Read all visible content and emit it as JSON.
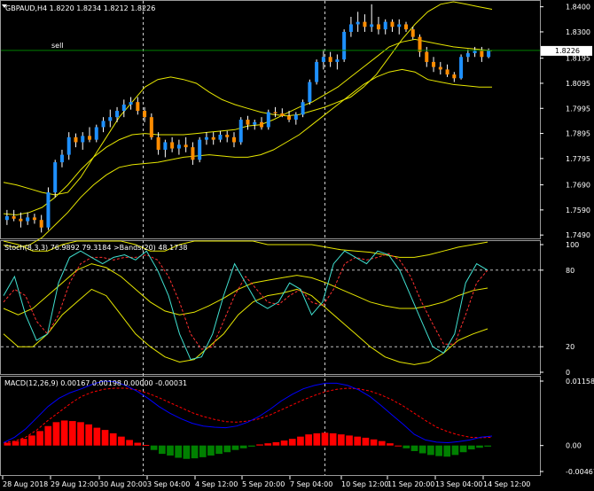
{
  "symbol_line": "GBPAUD,H4  1.8220 1.8234 1.8212 1.8226",
  "trade_label": "sell",
  "price_badge": "1.8226",
  "stoch_label": "Stoch(8,3,3) 76.9892 79.3184  >Bands(20) 48.1738",
  "macd_label": "MACD(12,26,9) 0.00167 0.00198 0.00000 -0.00031",
  "colors": {
    "bull": "#1e90ff",
    "bear": "#ff8c00",
    "band": "#e6e600",
    "stoch_main": "#40e0d0",
    "stoch_signal": "#ff3030",
    "macd_main": "#0000ff",
    "macd_signal": "#ff0000",
    "hist_pos": "#ff0000",
    "hist_neg": "#008000",
    "sell_line": "#008000",
    "grid": "#c0c0c0"
  },
  "chart_data": [
    {
      "type": "candlestick",
      "symbol": "GBPAUD",
      "timeframe": "H4",
      "yticks": [
        "1.8400",
        "1.8300",
        "1.8195",
        "1.8095",
        "1.7995",
        "1.7895",
        "1.7795",
        "1.7690",
        "1.7590",
        "1.7490"
      ],
      "ylim": [
        1.748,
        1.842
      ],
      "current_price": 1.8226,
      "sell_level": 1.8226,
      "candles": [
        [
          1.755,
          1.759,
          1.753,
          1.7565
        ],
        [
          1.7565,
          1.759,
          1.7545,
          1.7555
        ],
        [
          1.7555,
          1.758,
          1.752,
          1.7545
        ],
        [
          1.7545,
          1.758,
          1.753,
          1.756
        ],
        [
          1.756,
          1.7575,
          1.7535,
          1.755
        ],
        [
          1.755,
          1.757,
          1.75,
          1.752
        ],
        [
          1.752,
          1.768,
          1.751,
          1.766
        ],
        [
          1.766,
          1.779,
          1.764,
          1.778
        ],
        [
          1.778,
          1.783,
          1.776,
          1.781
        ],
        [
          1.781,
          1.79,
          1.779,
          1.788
        ],
        [
          1.788,
          1.7895,
          1.784,
          1.786
        ],
        [
          1.786,
          1.79,
          1.783,
          1.7885
        ],
        [
          1.7885,
          1.792,
          1.786,
          1.787
        ],
        [
          1.787,
          1.793,
          1.786,
          1.792
        ],
        [
          1.792,
          1.796,
          1.79,
          1.7945
        ],
        [
          1.7945,
          1.799,
          1.792,
          1.796
        ],
        [
          1.796,
          1.8,
          1.794,
          1.7985
        ],
        [
          1.7985,
          1.803,
          1.796,
          1.801
        ],
        [
          1.801,
          1.804,
          1.799,
          1.802
        ],
        [
          1.802,
          1.804,
          1.797,
          1.7985
        ],
        [
          1.7985,
          1.8,
          1.794,
          1.796
        ],
        [
          1.796,
          1.7975,
          1.787,
          1.788
        ],
        [
          1.788,
          1.79,
          1.781,
          1.783
        ],
        [
          1.783,
          1.787,
          1.78,
          1.786
        ],
        [
          1.786,
          1.788,
          1.782,
          1.7835
        ],
        [
          1.7835,
          1.787,
          1.781,
          1.785
        ],
        [
          1.785,
          1.788,
          1.782,
          1.784
        ],
        [
          1.784,
          1.786,
          1.777,
          1.779
        ],
        [
          1.779,
          1.788,
          1.778,
          1.787
        ],
        [
          1.787,
          1.79,
          1.785,
          1.788
        ],
        [
          1.788,
          1.79,
          1.785,
          1.787
        ],
        [
          1.787,
          1.7905,
          1.786,
          1.789
        ],
        [
          1.789,
          1.7905,
          1.786,
          1.788
        ],
        [
          1.788,
          1.79,
          1.784,
          1.786
        ],
        [
          1.786,
          1.796,
          1.785,
          1.795
        ],
        [
          1.795,
          1.7965,
          1.791,
          1.793
        ],
        [
          1.793,
          1.795,
          1.791,
          1.794
        ],
        [
          1.794,
          1.796,
          1.791,
          1.792
        ],
        [
          1.792,
          1.799,
          1.791,
          1.798
        ],
        [
          1.798,
          1.8,
          1.796,
          1.7975
        ],
        [
          1.7975,
          1.7995,
          1.796,
          1.7965
        ],
        [
          1.7965,
          1.7985,
          1.794,
          1.795
        ],
        [
          1.795,
          1.798,
          1.793,
          1.797
        ],
        [
          1.797,
          1.803,
          1.796,
          1.802
        ],
        [
          1.802,
          1.811,
          1.801,
          1.81
        ],
        [
          1.81,
          1.819,
          1.809,
          1.818
        ],
        [
          1.818,
          1.823,
          1.815,
          1.82
        ],
        [
          1.82,
          1.822,
          1.816,
          1.818
        ],
        [
          1.818,
          1.821,
          1.815,
          1.819
        ],
        [
          1.819,
          1.831,
          1.818,
          1.83
        ],
        [
          1.83,
          1.836,
          1.828,
          1.833
        ],
        [
          1.833,
          1.838,
          1.83,
          1.834
        ],
        [
          1.834,
          1.837,
          1.83,
          1.832
        ],
        [
          1.832,
          1.841,
          1.83,
          1.833
        ],
        [
          1.833,
          1.836,
          1.829,
          1.831
        ],
        [
          1.831,
          1.835,
          1.829,
          1.834
        ],
        [
          1.834,
          1.835,
          1.83,
          1.832
        ],
        [
          1.832,
          1.835,
          1.829,
          1.833
        ],
        [
          1.833,
          1.834,
          1.83,
          1.831
        ],
        [
          1.831,
          1.832,
          1.827,
          1.828
        ],
        [
          1.828,
          1.829,
          1.82,
          1.822
        ],
        [
          1.822,
          1.824,
          1.816,
          1.818
        ],
        [
          1.818,
          1.82,
          1.814,
          1.816
        ],
        [
          1.816,
          1.818,
          1.813,
          1.815
        ],
        [
          1.815,
          1.817,
          1.812,
          1.813
        ],
        [
          1.813,
          1.814,
          1.81,
          1.8115
        ],
        [
          1.8115,
          1.821,
          1.811,
          1.82
        ],
        [
          1.82,
          1.823,
          1.818,
          1.8215
        ],
        [
          1.8215,
          1.824,
          1.82,
          1.8225
        ],
        [
          1.8225,
          1.824,
          1.818,
          1.82
        ],
        [
          1.82,
          1.8234,
          1.8195,
          1.8226
        ]
      ],
      "bands": {
        "upper": [
          1.77,
          1.769,
          1.7675,
          1.766,
          1.765,
          1.766,
          1.772,
          1.78,
          1.788,
          1.796,
          1.802,
          1.808,
          1.811,
          1.812,
          1.811,
          1.8095,
          1.806,
          1.803,
          1.801,
          1.7995,
          1.798,
          1.797,
          1.7965,
          1.797,
          1.7985,
          1.8,
          1.802,
          1.804,
          1.808,
          1.813,
          1.82,
          1.827,
          1.833,
          1.838,
          1.841,
          1.842,
          1.841,
          1.84,
          1.839
        ],
        "middle": [
          1.7575,
          1.757,
          1.758,
          1.76,
          1.764,
          1.769,
          1.775,
          1.78,
          1.784,
          1.787,
          1.789,
          1.7895,
          1.789,
          1.789,
          1.789,
          1.7895,
          1.79,
          1.7905,
          1.791,
          1.7925,
          1.793,
          1.795,
          1.7975,
          1.8,
          1.802,
          1.805,
          1.808,
          1.812,
          1.816,
          1.82,
          1.824,
          1.826,
          1.827,
          1.826,
          1.825,
          1.824,
          1.8235,
          1.823,
          1.8225
        ],
        "lower": [
          1.745,
          1.744,
          1.745,
          1.748,
          1.753,
          1.758,
          1.764,
          1.769,
          1.773,
          1.776,
          1.777,
          1.7775,
          1.778,
          1.779,
          1.78,
          1.7805,
          1.781,
          1.7805,
          1.78,
          1.78,
          1.781,
          1.783,
          1.786,
          1.789,
          1.793,
          1.797,
          1.801,
          1.805,
          1.809,
          1.812,
          1.814,
          1.815,
          1.814,
          1.811,
          1.81,
          1.809,
          1.8085,
          1.808,
          1.808
        ]
      }
    },
    {
      "type": "line",
      "name": "Stoch(8,3,3)",
      "yticks": [
        "100",
        "80",
        "20",
        "0"
      ],
      "ylim": [
        0,
        100
      ],
      "levels": [
        80,
        20
      ],
      "main": [
        60,
        75,
        45,
        25,
        30,
        70,
        90,
        95,
        90,
        85,
        90,
        92,
        88,
        95,
        80,
        60,
        30,
        10,
        12,
        30,
        60,
        85,
        70,
        55,
        50,
        55,
        70,
        65,
        45,
        55,
        85,
        95,
        90,
        85,
        95,
        92,
        80,
        60,
        40,
        20,
        15,
        30,
        70,
        85,
        80
      ],
      "signal": [
        55,
        65,
        60,
        40,
        30,
        45,
        70,
        85,
        90,
        90,
        88,
        90,
        90,
        92,
        88,
        75,
        55,
        30,
        18,
        20,
        40,
        60,
        75,
        65,
        55,
        53,
        60,
        65,
        55,
        52,
        65,
        85,
        90,
        88,
        90,
        93,
        88,
        75,
        55,
        38,
        22,
        22,
        45,
        70,
        80
      ],
      "bands": {
        "upper": [
          105,
          100,
          95,
          95,
          100,
          105,
          110,
          110,
          105,
          100,
          95,
          95,
          100,
          105,
          108,
          110,
          110,
          105,
          100,
          100,
          100,
          100,
          98,
          96,
          95,
          94,
          92,
          90,
          90,
          92,
          95,
          98,
          100,
          102
        ],
        "middle": [
          50,
          45,
          50,
          60,
          70,
          80,
          85,
          82,
          75,
          65,
          55,
          48,
          45,
          47,
          52,
          58,
          65,
          70,
          72,
          74,
          76,
          74,
          70,
          65,
          60,
          55,
          52,
          50,
          50,
          52,
          55,
          60,
          64,
          66
        ],
        "lower": [
          30,
          20,
          20,
          30,
          45,
          55,
          65,
          60,
          45,
          30,
          20,
          12,
          8,
          10,
          20,
          30,
          45,
          55,
          60,
          62,
          65,
          60,
          50,
          40,
          30,
          20,
          12,
          8,
          6,
          8,
          15,
          25,
          30,
          34
        ]
      }
    },
    {
      "type": "bar+line",
      "name": "MACD(12,26,9)",
      "yticks": [
        "0.01158",
        "0.00",
        "-0.00467"
      ],
      "ylim": [
        -0.00467,
        0.01158
      ],
      "histogram": [
        0.0005,
        0.0008,
        0.0012,
        0.0018,
        0.0026,
        0.0035,
        0.0042,
        0.0045,
        0.0044,
        0.0042,
        0.0038,
        0.0032,
        0.0028,
        0.0022,
        0.0016,
        0.001,
        0.0005,
        0.0001,
        -0.0008,
        -0.0015,
        -0.0018,
        -0.0022,
        -0.0024,
        -0.0023,
        -0.0021,
        -0.0018,
        -0.0015,
        -0.0012,
        -0.0008,
        -0.0005,
        -0.0002,
        0.0002,
        0.0004,
        0.0006,
        0.0009,
        0.0012,
        0.0016,
        0.002,
        0.0022,
        0.0023,
        0.0022,
        0.002,
        0.0018,
        0.0016,
        0.0014,
        0.0011,
        0.0008,
        0.0004,
        0.0,
        -0.0005,
        -0.001,
        -0.0014,
        -0.0017,
        -0.0019,
        -0.002,
        -0.0017,
        -0.0012,
        -0.0007,
        -0.0004,
        -0.0002
      ],
      "main": [
        0.0005,
        0.0015,
        0.003,
        0.005,
        0.007,
        0.0085,
        0.0095,
        0.0102,
        0.011,
        0.0116,
        0.0115,
        0.0108,
        0.0098,
        0.0085,
        0.007,
        0.0058,
        0.0048,
        0.004,
        0.0035,
        0.0033,
        0.0032,
        0.0035,
        0.0042,
        0.0052,
        0.0065,
        0.008,
        0.0092,
        0.0102,
        0.0108,
        0.0112,
        0.0112,
        0.0108,
        0.01,
        0.0088,
        0.0072,
        0.0055,
        0.0038,
        0.002,
        0.001,
        0.0006,
        0.0005,
        0.0007,
        0.001,
        0.0015,
        0.0017
      ],
      "signal": [
        0.0005,
        0.0008,
        0.0015,
        0.0028,
        0.0045,
        0.006,
        0.0075,
        0.0088,
        0.0096,
        0.0101,
        0.0103,
        0.0103,
        0.01,
        0.0094,
        0.0086,
        0.0077,
        0.0068,
        0.0059,
        0.0052,
        0.0047,
        0.0043,
        0.0042,
        0.0044,
        0.0048,
        0.0055,
        0.0064,
        0.0073,
        0.0082,
        0.009,
        0.0097,
        0.0101,
        0.0103,
        0.0102,
        0.0098,
        0.0091,
        0.0082,
        0.0071,
        0.0058,
        0.0045,
        0.0033,
        0.0025,
        0.0019,
        0.0015,
        0.0014,
        0.0015
      ]
    }
  ],
  "time_axis": [
    "28 Aug 2018",
    "29 Aug 12:00",
    "30 Aug 20:00",
    "3 Sep 04:00",
    "4 Sep 12:00",
    "5 Sep 20:00",
    "7 Sep 04:00",
    "10 Sep 12:00",
    "11 Sep 20:00",
    "13 Sep 04:00",
    "14 Sep 12:00"
  ]
}
